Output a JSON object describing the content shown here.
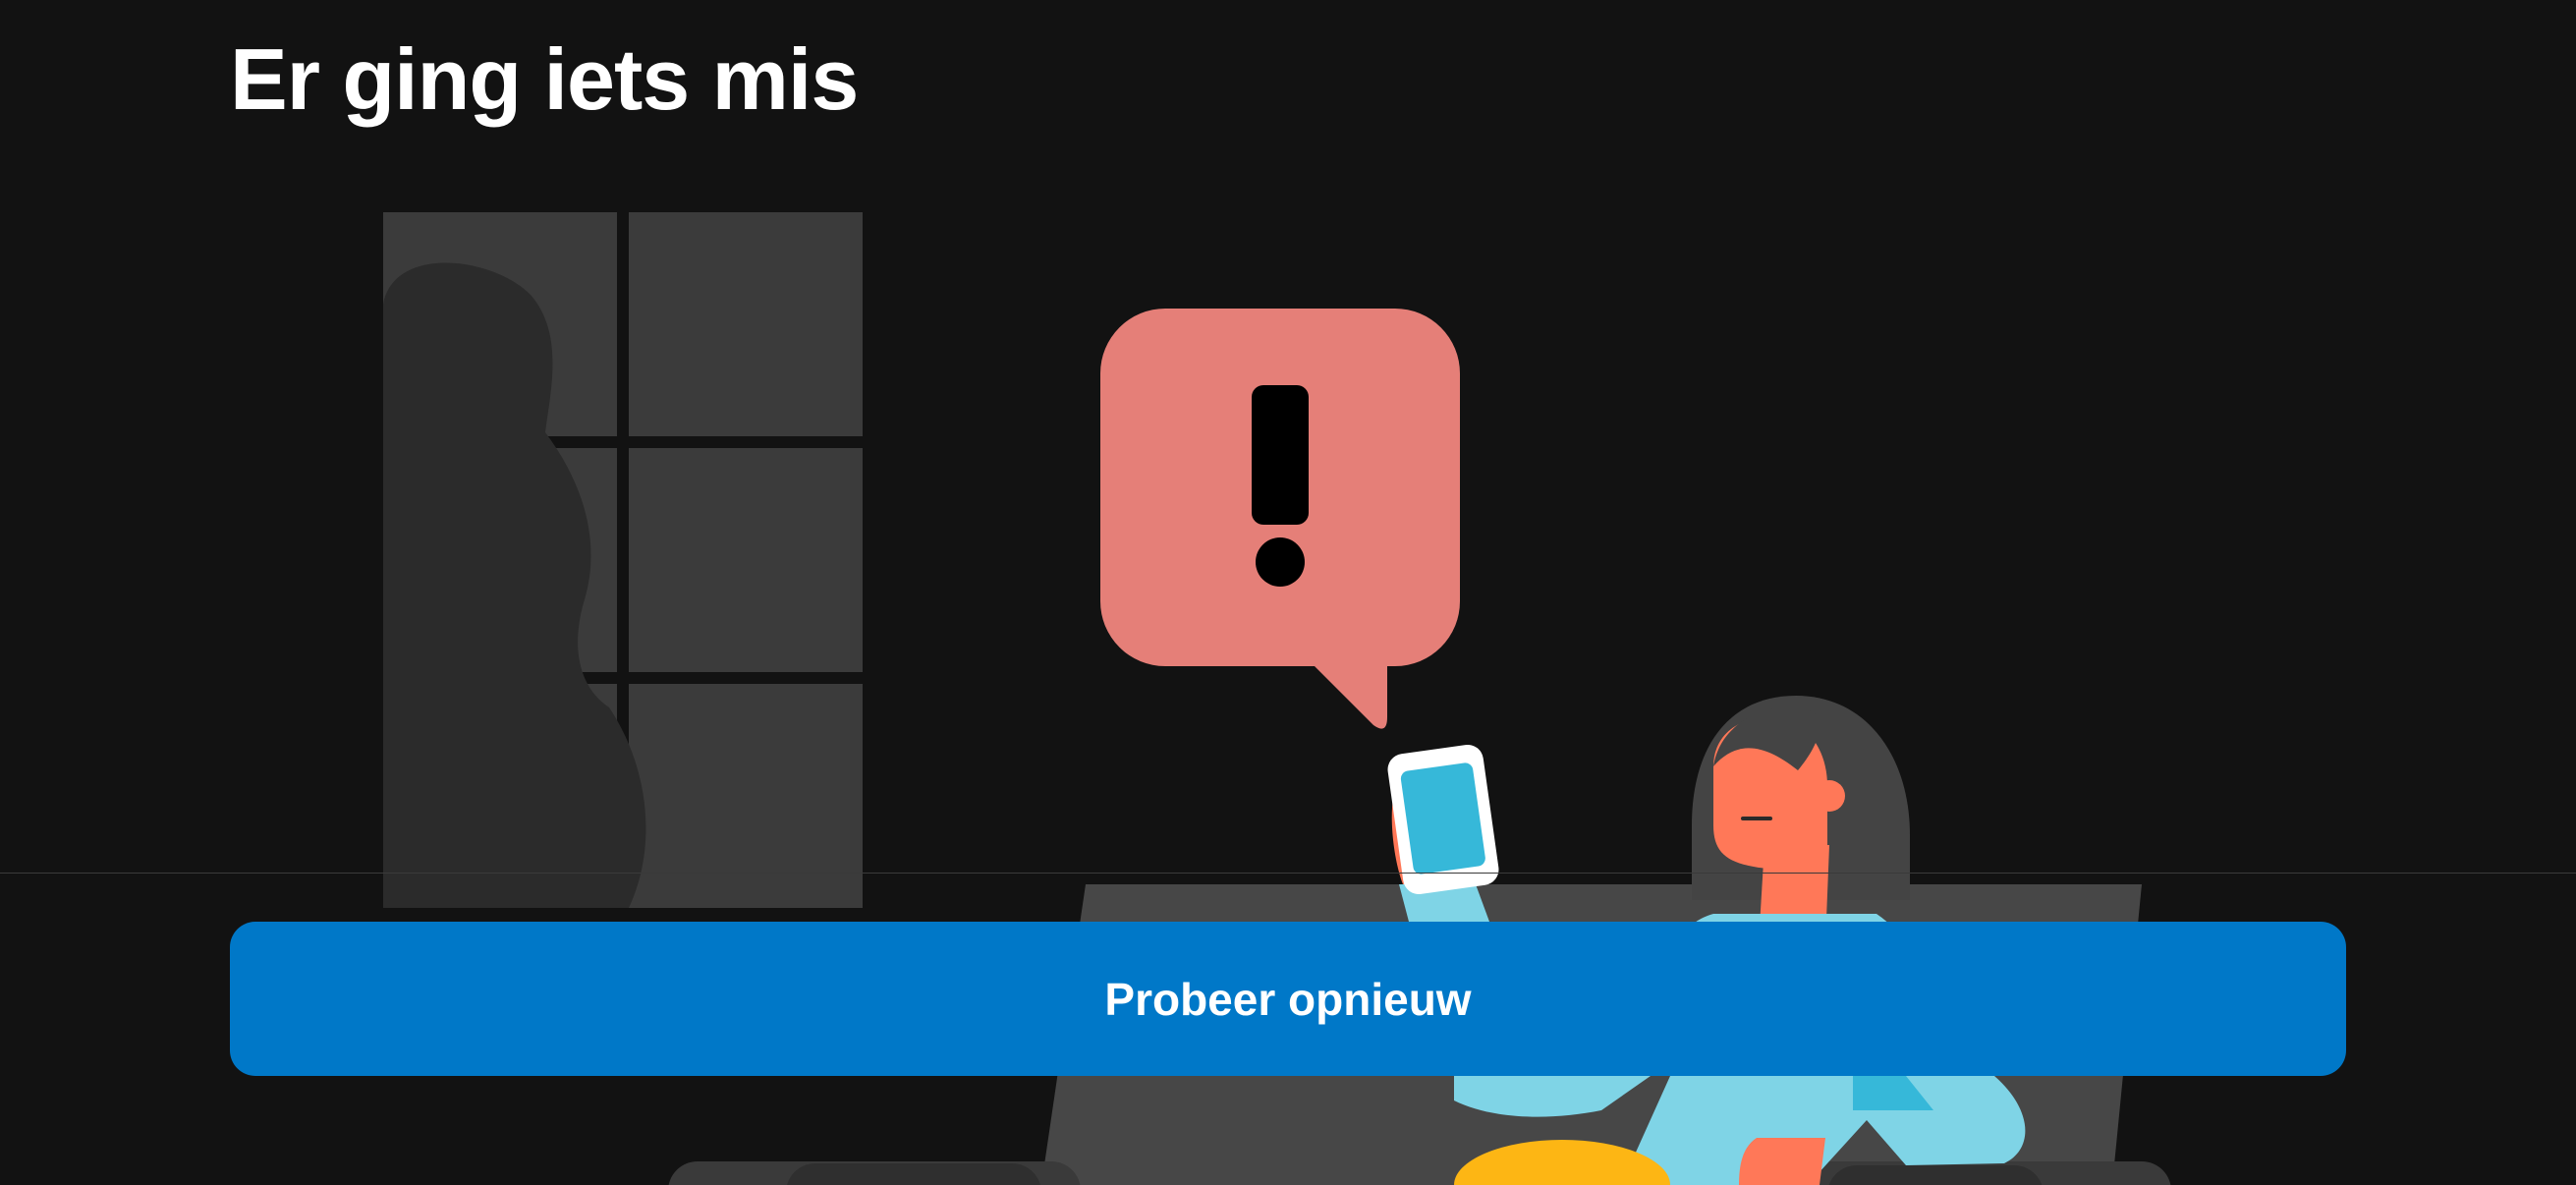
{
  "error": {
    "title": "Er ging iets mis"
  },
  "actions": {
    "retry_label": "Probeer opnieuw"
  },
  "icons": {
    "alert": "exclamation-speech-bubble-icon",
    "phone": "smartphone-icon"
  },
  "colors": {
    "background": "#121212",
    "primary_button": "#0078c8",
    "alert_bubble": "#e57f78",
    "text": "#ffffff"
  }
}
